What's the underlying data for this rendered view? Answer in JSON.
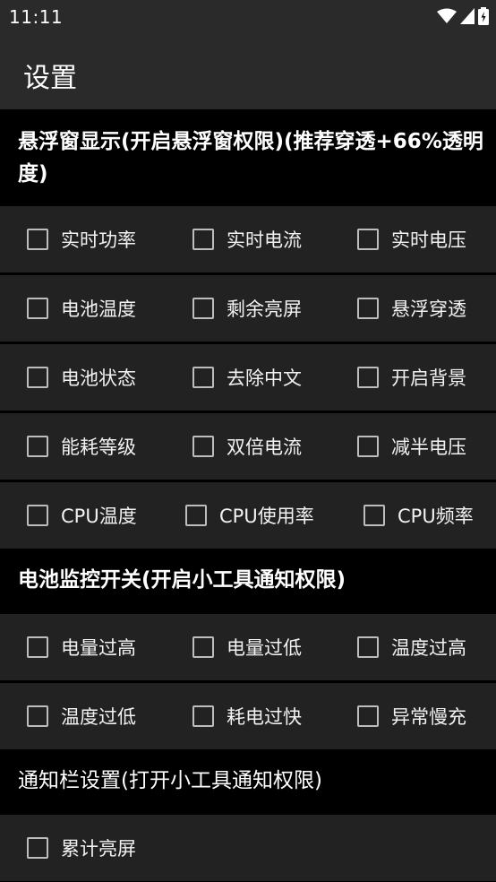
{
  "status_bar": {
    "time": "11:11",
    "icons": [
      "wifi-icon",
      "signal-icon",
      "battery-icon"
    ]
  },
  "app_bar": {
    "title": "设置"
  },
  "sections": {
    "float": {
      "title_line1": "悬浮窗显示(开启悬浮窗权限)(推荐穿透+66%透明",
      "title_line2": "度)",
      "options": [
        [
          "实时功率",
          "实时电流",
          "实时电压"
        ],
        [
          "电池温度",
          "剩余亮屏",
          "悬浮穿透"
        ],
        [
          "电池状态",
          "去除中文",
          "开启背景"
        ],
        [
          "能耗等级",
          "双倍电流",
          "减半电压"
        ],
        [
          "CPU温度",
          "CPU使用率",
          "CPU频率"
        ]
      ]
    },
    "battery": {
      "title": "电池监控开关(开启小工具通知权限)",
      "options": [
        [
          "电量过高",
          "电量过低",
          "温度过高"
        ],
        [
          "温度过低",
          "耗电过快",
          "异常慢充"
        ]
      ]
    },
    "notify": {
      "title": "通知栏设置(打开小工具通知权限)",
      "options": [
        [
          "累计亮屏"
        ]
      ]
    }
  }
}
